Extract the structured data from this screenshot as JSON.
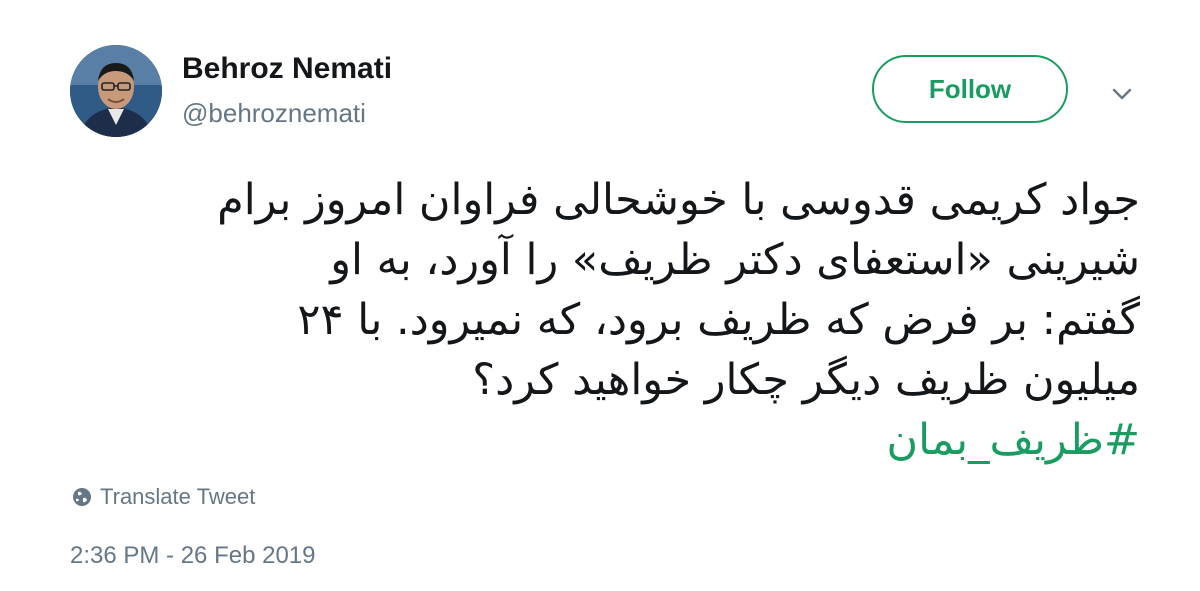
{
  "author": {
    "name": "Behroz Nemati",
    "handle": "@behroznemati",
    "avatar_icon": "profile-photo"
  },
  "follow_button": {
    "label": "Follow",
    "color": "#1a9c60"
  },
  "menu_icon": "chevron-down-icon",
  "tweet": {
    "lines": [
      "جواد کریمی قدوسی با خوشحالی فراوان امروز برام",
      "شیرینی «استعفای دکتر ظریف» را آورد، به او",
      "گفتم: بر فرض که ظریف برود، که نمیرود. با ۲۴",
      "میلیون ظریف دیگر چکار خواهید کرد؟"
    ],
    "hashtag": "#ظریف_بمان",
    "hashtag_color": "#1a9c60"
  },
  "translate": {
    "label": "Translate Tweet",
    "icon": "globe-icon"
  },
  "timestamp": "2:36 PM - 26 Feb 2019"
}
